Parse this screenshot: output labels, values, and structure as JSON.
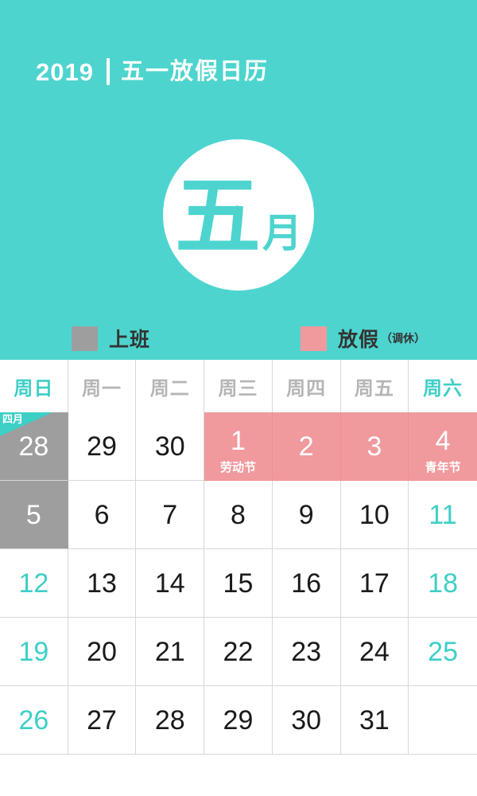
{
  "header": {
    "year": "2019",
    "title": "五一放假日历"
  },
  "month_badge": {
    "main": "五",
    "suffix": "月"
  },
  "legend": {
    "work": {
      "label": "上班",
      "color": "#9e9e9e"
    },
    "off": {
      "label": "放假",
      "sub": "（调休）",
      "color": "#f09a9d"
    }
  },
  "colors": {
    "accent_teal": "#4ed4ce",
    "weekend_text": "#3ecfc7",
    "work_gray": "#9e9e9e",
    "holiday_pink": "#f09a9d",
    "weekday_header": "#b5b5b5",
    "grid_line": "#d8d8d8"
  },
  "weekdays": [
    {
      "label": "周日",
      "weekend": true
    },
    {
      "label": "周一",
      "weekend": false
    },
    {
      "label": "周二",
      "weekend": false
    },
    {
      "label": "周三",
      "weekend": false
    },
    {
      "label": "周四",
      "weekend": false
    },
    {
      "label": "周五",
      "weekend": false
    },
    {
      "label": "周六",
      "weekend": true
    }
  ],
  "weeks": [
    [
      {
        "day": "28",
        "type": "work",
        "note": "",
        "ribbon": "四月",
        "weekend": true
      },
      {
        "day": "29",
        "type": "normal",
        "note": "",
        "ribbon": "",
        "weekend": false
      },
      {
        "day": "30",
        "type": "normal",
        "note": "",
        "ribbon": "",
        "weekend": false
      },
      {
        "day": "1",
        "type": "off",
        "note": "劳动节",
        "ribbon": "",
        "weekend": false
      },
      {
        "day": "2",
        "type": "off",
        "note": "",
        "ribbon": "",
        "weekend": false
      },
      {
        "day": "3",
        "type": "off",
        "note": "",
        "ribbon": "",
        "weekend": false
      },
      {
        "day": "4",
        "type": "off",
        "note": "青年节",
        "ribbon": "",
        "weekend": true
      }
    ],
    [
      {
        "day": "5",
        "type": "work",
        "note": "",
        "ribbon": "",
        "weekend": true
      },
      {
        "day": "6",
        "type": "normal",
        "note": "",
        "ribbon": "",
        "weekend": false
      },
      {
        "day": "7",
        "type": "normal",
        "note": "",
        "ribbon": "",
        "weekend": false
      },
      {
        "day": "8",
        "type": "normal",
        "note": "",
        "ribbon": "",
        "weekend": false
      },
      {
        "day": "9",
        "type": "normal",
        "note": "",
        "ribbon": "",
        "weekend": false
      },
      {
        "day": "10",
        "type": "normal",
        "note": "",
        "ribbon": "",
        "weekend": false
      },
      {
        "day": "11",
        "type": "normal",
        "note": "",
        "ribbon": "",
        "weekend": true
      }
    ],
    [
      {
        "day": "12",
        "type": "normal",
        "note": "",
        "ribbon": "",
        "weekend": true
      },
      {
        "day": "13",
        "type": "normal",
        "note": "",
        "ribbon": "",
        "weekend": false
      },
      {
        "day": "14",
        "type": "normal",
        "note": "",
        "ribbon": "",
        "weekend": false
      },
      {
        "day": "15",
        "type": "normal",
        "note": "",
        "ribbon": "",
        "weekend": false
      },
      {
        "day": "16",
        "type": "normal",
        "note": "",
        "ribbon": "",
        "weekend": false
      },
      {
        "day": "17",
        "type": "normal",
        "note": "",
        "ribbon": "",
        "weekend": false
      },
      {
        "day": "18",
        "type": "normal",
        "note": "",
        "ribbon": "",
        "weekend": true
      }
    ],
    [
      {
        "day": "19",
        "type": "normal",
        "note": "",
        "ribbon": "",
        "weekend": true
      },
      {
        "day": "20",
        "type": "normal",
        "note": "",
        "ribbon": "",
        "weekend": false
      },
      {
        "day": "21",
        "type": "normal",
        "note": "",
        "ribbon": "",
        "weekend": false
      },
      {
        "day": "22",
        "type": "normal",
        "note": "",
        "ribbon": "",
        "weekend": false
      },
      {
        "day": "23",
        "type": "normal",
        "note": "",
        "ribbon": "",
        "weekend": false
      },
      {
        "day": "24",
        "type": "normal",
        "note": "",
        "ribbon": "",
        "weekend": false
      },
      {
        "day": "25",
        "type": "normal",
        "note": "",
        "ribbon": "",
        "weekend": true
      }
    ],
    [
      {
        "day": "26",
        "type": "normal",
        "note": "",
        "ribbon": "",
        "weekend": true
      },
      {
        "day": "27",
        "type": "normal",
        "note": "",
        "ribbon": "",
        "weekend": false
      },
      {
        "day": "28",
        "type": "normal",
        "note": "",
        "ribbon": "",
        "weekend": false
      },
      {
        "day": "29",
        "type": "normal",
        "note": "",
        "ribbon": "",
        "weekend": false
      },
      {
        "day": "30",
        "type": "normal",
        "note": "",
        "ribbon": "",
        "weekend": false
      },
      {
        "day": "31",
        "type": "normal",
        "note": "",
        "ribbon": "",
        "weekend": false
      },
      {
        "day": "",
        "type": "empty",
        "note": "",
        "ribbon": "",
        "weekend": true
      }
    ]
  ]
}
